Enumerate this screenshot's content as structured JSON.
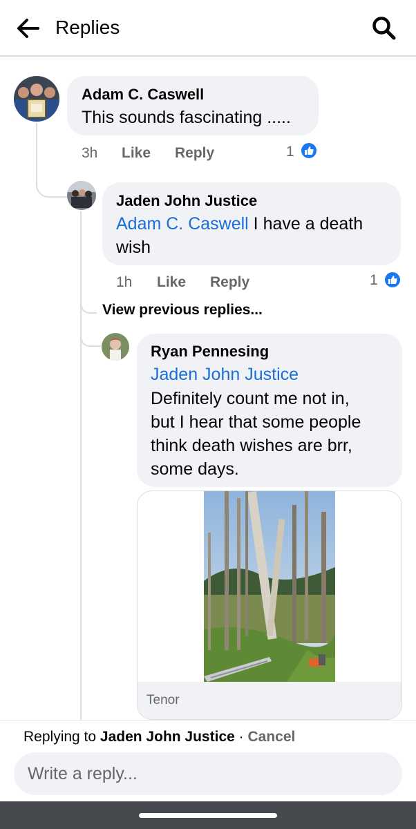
{
  "header": {
    "title": "Replies",
    "back_icon": "arrow-left-icon",
    "search_icon": "search-icon"
  },
  "comments": [
    {
      "author": "Adam C. Caswell",
      "mention": "",
      "text": "This sounds fascinating .....",
      "time": "3h",
      "like_label": "Like",
      "reply_label": "Reply",
      "reaction_count": "1"
    },
    {
      "author": "Jaden John Justice",
      "mention": "Adam C. Caswell",
      "text_line1": " I have a death",
      "text_line2": "wish",
      "time": "1h",
      "like_label": "Like",
      "reply_label": "Reply",
      "reaction_count": "1"
    },
    {
      "author": "Ryan Pennesing",
      "mention": "Jaden John Justice",
      "lines": [
        "Definitely count me not in,",
        "but I hear that some people",
        "think death wishes are brr,",
        "some days."
      ],
      "gif_source": "Tenor"
    }
  ],
  "view_previous": "View previous replies...",
  "composer": {
    "replying_prefix": "Replying to ",
    "replying_to": "Jaden John Justice",
    "separator": " · ",
    "cancel": "Cancel",
    "placeholder": "Write a reply..."
  },
  "colors": {
    "accent": "#1877f2",
    "mention": "#1a6ed8",
    "bubble": "#f0f2f5",
    "muted": "#65676b"
  }
}
